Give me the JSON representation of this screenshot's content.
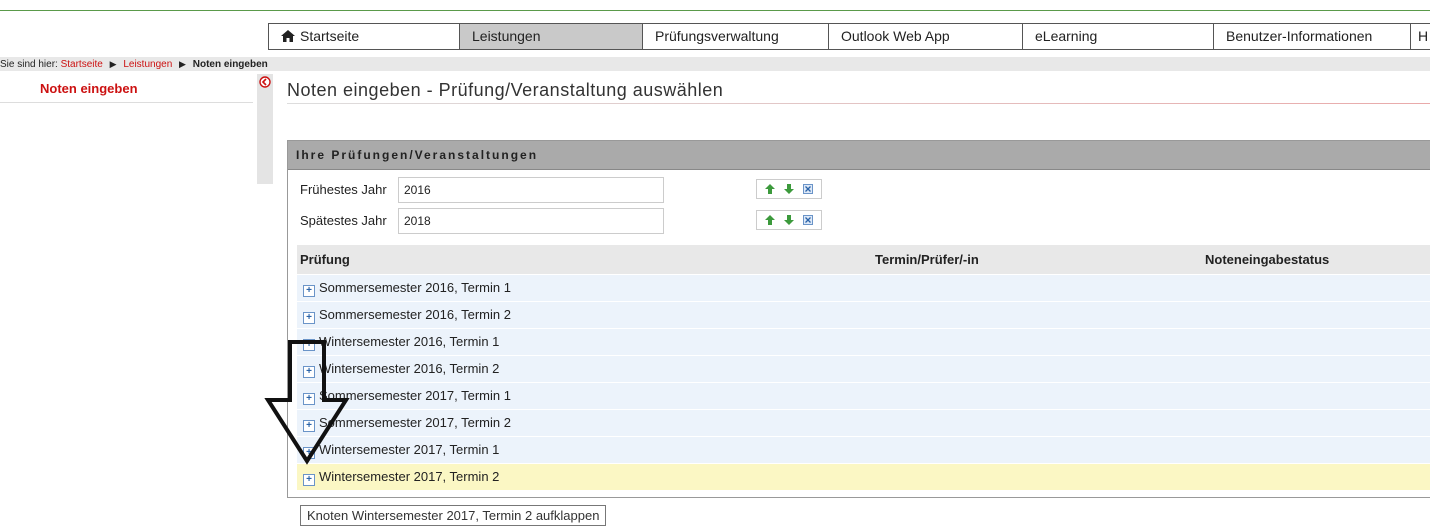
{
  "nav": {
    "items": [
      {
        "label": "Startseite",
        "active": false,
        "icon": "home-icon"
      },
      {
        "label": "Leistungen",
        "active": true
      },
      {
        "label": "Prüfungsverwaltung",
        "active": false
      },
      {
        "label": "Outlook Web App",
        "active": false
      },
      {
        "label": "eLearning",
        "active": false
      },
      {
        "label": "Benutzer-Informationen",
        "active": false
      },
      {
        "label": "H",
        "active": false
      }
    ]
  },
  "breadcrumb": {
    "prefix": "Sie sind hier:",
    "links": [
      "Startseite",
      "Leistungen"
    ],
    "current": "Noten eingeben",
    "separator": "▶"
  },
  "leftnav": {
    "items": [
      {
        "label": "Noten eingeben"
      }
    ]
  },
  "page": {
    "title": "Noten eingeben - Prüfung/Veranstaltung auswählen"
  },
  "panel": {
    "title": "Ihre Prüfungen/Veranstaltungen",
    "filters": [
      {
        "label": "Frühestes Jahr",
        "value": "2016"
      },
      {
        "label": "Spätestes Jahr",
        "value": "2018"
      }
    ]
  },
  "table": {
    "headers": [
      "Prüfung",
      "Termin/Prüfer/-in",
      "Noteneingabestatus"
    ],
    "rows": [
      {
        "label": "Sommersemester 2016, Termin 1"
      },
      {
        "label": "Sommersemester 2016, Termin 2"
      },
      {
        "label": "Wintersemester 2016, Termin 1"
      },
      {
        "label": "Wintersemester 2016, Termin 2"
      },
      {
        "label": "Sommersemester 2017, Termin 1"
      },
      {
        "label": "Sommersemester 2017, Termin 2"
      },
      {
        "label": "Wintersemester 2017, Termin 1"
      },
      {
        "label": "Wintersemester 2017, Termin 2",
        "highlighted": true
      }
    ]
  },
  "tooltip": {
    "text": "Knoten Wintersemester 2017, Termin 2 aufklappen"
  },
  "colors": {
    "accent_red": "#cc1111",
    "highlight_row": "#fbf7c4",
    "row_bg": "#ecf3fb",
    "header_gray": "#aaaaaa",
    "active_tab": "#c9c9c9"
  }
}
